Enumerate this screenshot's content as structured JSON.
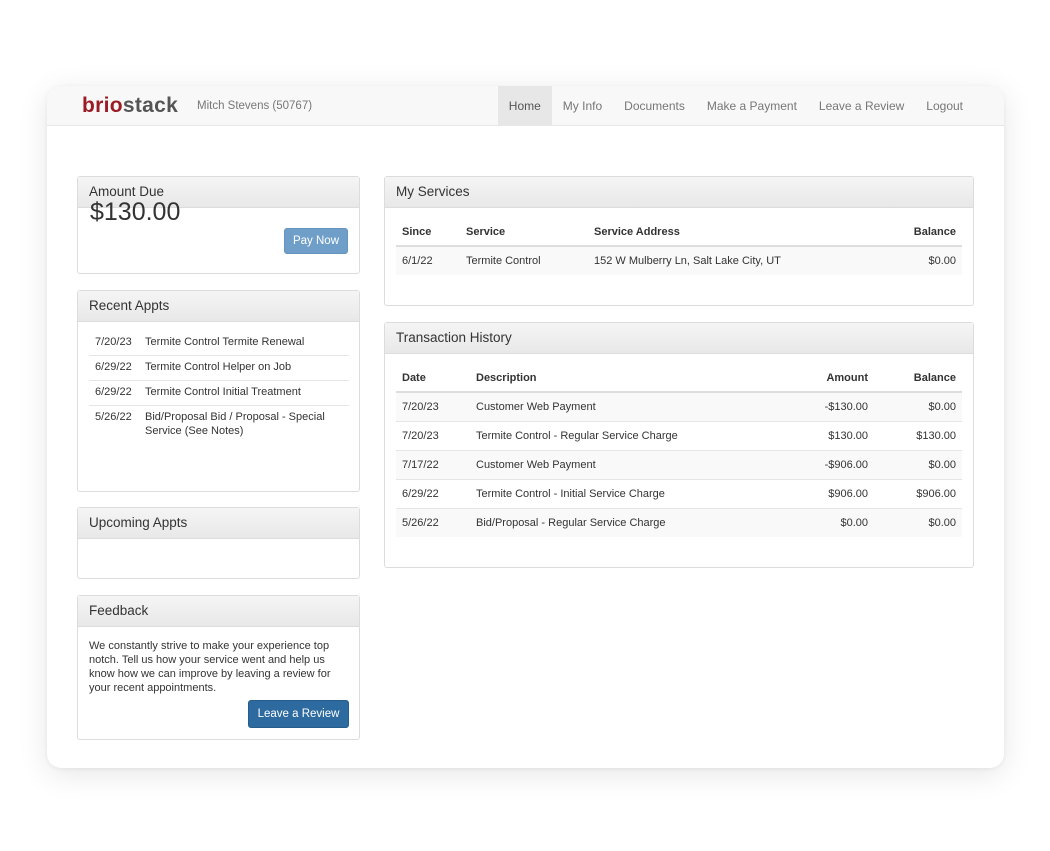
{
  "brand": {
    "part1": "brio",
    "part2": "stack"
  },
  "user": "Mitch Stevens (50767)",
  "nav": [
    {
      "label": "Home",
      "active": true
    },
    {
      "label": "My Info"
    },
    {
      "label": "Documents"
    },
    {
      "label": "Make a Payment"
    },
    {
      "label": "Leave a Review"
    },
    {
      "label": "Logout"
    }
  ],
  "amount_due": {
    "title": "Amount Due",
    "amount": "$130.00",
    "button": "Pay Now"
  },
  "recent_appts": {
    "title": "Recent Appts",
    "items": [
      {
        "date": "7/20/23",
        "text": "Termite Control Termite Renewal"
      },
      {
        "date": "6/29/22",
        "text": "Termite Control Helper on Job"
      },
      {
        "date": "6/29/22",
        "text": "Termite Control Initial Treatment"
      },
      {
        "date": "5/26/22",
        "text": "Bid/Proposal Bid / Proposal - Special Service (See Notes)"
      }
    ]
  },
  "upcoming_appts": {
    "title": "Upcoming Appts"
  },
  "feedback": {
    "title": "Feedback",
    "text": "We constantly strive to make your experience top notch. Tell us how your service went and help us know how we can improve by leaving a review for your recent appointments.",
    "button": "Leave a Review"
  },
  "services": {
    "title": "My Services",
    "headers": [
      "Since",
      "Service",
      "Service Address",
      "Balance"
    ],
    "rows": [
      [
        "6/1/22",
        "Termite Control",
        "152 W Mulberry Ln, Salt Lake City, UT",
        "$0.00"
      ]
    ]
  },
  "transactions": {
    "title": "Transaction History",
    "headers": [
      "Date",
      "Description",
      "Amount",
      "Balance"
    ],
    "rows": [
      [
        "7/20/23",
        "Customer Web Payment",
        "-$130.00",
        "$0.00"
      ],
      [
        "7/20/23",
        "Termite Control - Regular Service Charge",
        "$130.00",
        "$130.00"
      ],
      [
        "7/17/22",
        "Customer Web Payment",
        "-$906.00",
        "$0.00"
      ],
      [
        "6/29/22",
        "Termite Control - Initial Service Charge",
        "$906.00",
        "$906.00"
      ],
      [
        "5/26/22",
        "Bid/Proposal - Regular Service Charge",
        "$0.00",
        "$0.00"
      ]
    ]
  }
}
